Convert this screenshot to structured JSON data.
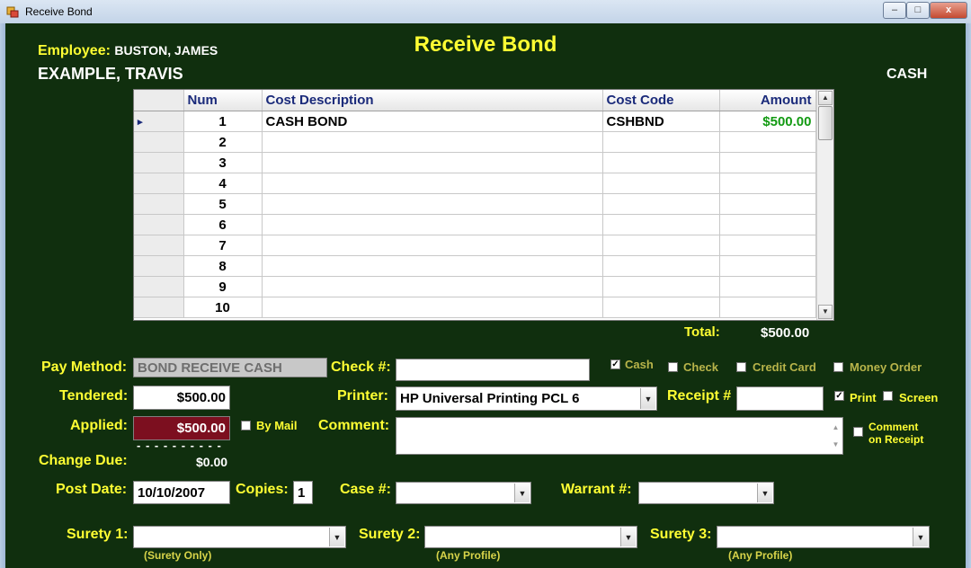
{
  "window": {
    "title": "Receive Bond",
    "controls": {
      "minimize": "–",
      "maximize": "□",
      "close": "x"
    }
  },
  "heading": "Receive Bond",
  "employee": {
    "label": "Employee:",
    "name": "BUSTON, JAMES"
  },
  "person": "EXAMPLE, TRAVIS",
  "payment_type": "CASH",
  "grid": {
    "columns": [
      "Num",
      "Cost Description",
      "Cost Code",
      "Amount"
    ],
    "rows": [
      {
        "num": "1",
        "description": "CASH BOND",
        "code": "CSHBND",
        "amount": "$500.00"
      },
      {
        "num": "2",
        "description": "",
        "code": "",
        "amount": ""
      },
      {
        "num": "3",
        "description": "",
        "code": "",
        "amount": ""
      },
      {
        "num": "4",
        "description": "",
        "code": "",
        "amount": ""
      },
      {
        "num": "5",
        "description": "",
        "code": "",
        "amount": ""
      },
      {
        "num": "6",
        "description": "",
        "code": "",
        "amount": ""
      },
      {
        "num": "7",
        "description": "",
        "code": "",
        "amount": ""
      },
      {
        "num": "8",
        "description": "",
        "code": "",
        "amount": ""
      },
      {
        "num": "9",
        "description": "",
        "code": "",
        "amount": ""
      },
      {
        "num": "10",
        "description": "",
        "code": "",
        "amount": ""
      }
    ],
    "current_row_marker": "▸"
  },
  "total": {
    "label": "Total:",
    "value": "$500.00"
  },
  "pay_method": {
    "label": "Pay Method:",
    "value": "BOND RECEIVE CASH"
  },
  "check_num": {
    "label": "Check #:",
    "value": ""
  },
  "payment_options": [
    {
      "label": "Cash",
      "checked": true
    },
    {
      "label": "Check",
      "checked": false
    },
    {
      "label": "Credit Card",
      "checked": false
    },
    {
      "label": "Money Order",
      "checked": false
    }
  ],
  "tendered": {
    "label": "Tendered:",
    "value": "$500.00"
  },
  "printer": {
    "label": "Printer:",
    "value": "HP Universal Printing PCL 6"
  },
  "receipt": {
    "label": "Receipt #",
    "value": ""
  },
  "output_options": [
    {
      "label": "Print",
      "checked": true
    },
    {
      "label": "Screen",
      "checked": false
    }
  ],
  "applied": {
    "label": "Applied:",
    "value": "$500.00"
  },
  "by_mail": {
    "label": "By Mail",
    "checked": false
  },
  "comment": {
    "label": "Comment:",
    "value": ""
  },
  "comment_on_receipt": {
    "line1": "Comment",
    "line2": "on Receipt",
    "checked": false
  },
  "dashes": "- - - - - - - - - -",
  "change_due": {
    "label": "Change Due:",
    "value": "$0.00"
  },
  "post_date": {
    "label": "Post Date:",
    "value": "10/10/2007"
  },
  "copies": {
    "label": "Copies:",
    "value": "1"
  },
  "case_num": {
    "label": "Case #:",
    "value": ""
  },
  "warrant_num": {
    "label": "Warrant #:",
    "value": ""
  },
  "surety": [
    {
      "label": "Surety 1:",
      "value": "",
      "hint": "(Surety Only)"
    },
    {
      "label": "Surety 2:",
      "value": "",
      "hint": "(Any Profile)"
    },
    {
      "label": "Surety 3:",
      "value": "",
      "hint": "(Any Profile)"
    }
  ],
  "colors": {
    "background": "#102f0e",
    "label": "#ffff33",
    "amount": "#129a12",
    "applied_bg": "#7c0f1f"
  }
}
